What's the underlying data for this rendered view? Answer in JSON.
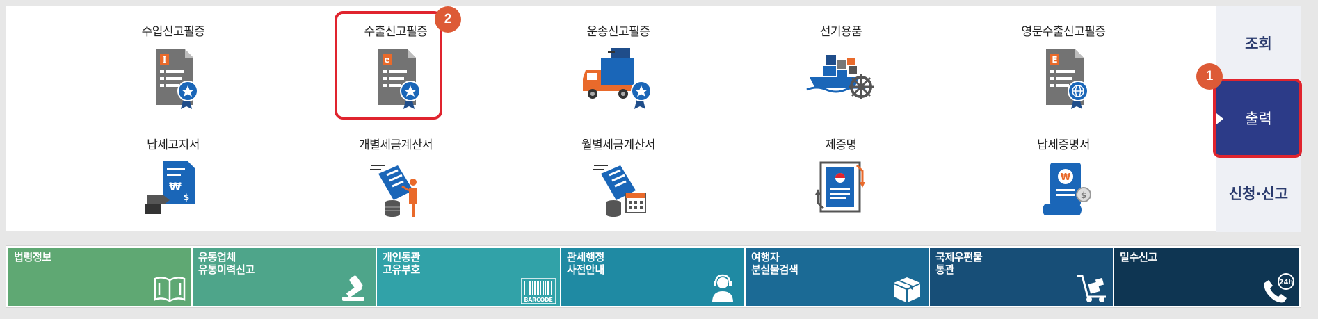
{
  "top_items": [
    {
      "label": "수입신고필증",
      "icon": "import-certificate-icon"
    },
    {
      "label": "수출신고필증",
      "icon": "export-certificate-icon"
    },
    {
      "label": "운송신고필증",
      "icon": "transport-certificate-icon"
    },
    {
      "label": "선기용품",
      "icon": "ship-supplies-icon"
    },
    {
      "label": "영문수출신고필증",
      "icon": "english-export-certificate-icon"
    },
    {
      "label": "납세고지서",
      "icon": "tax-notice-icon"
    },
    {
      "label": "개별세금계산서",
      "icon": "individual-tax-invoice-icon"
    },
    {
      "label": "월별세금계산서",
      "icon": "monthly-tax-invoice-icon"
    },
    {
      "label": "제증명",
      "icon": "certificate-icon"
    },
    {
      "label": "납세증명서",
      "icon": "tax-payment-certificate-icon"
    }
  ],
  "side_menu": [
    {
      "label": "조회",
      "active": false
    },
    {
      "label": "출력",
      "active": true
    },
    {
      "label": "신청·신고",
      "active": false
    }
  ],
  "badges": {
    "side": "1",
    "item": "2"
  },
  "tiles": [
    {
      "line1": "법령정보",
      "line2": "",
      "icon": "book-icon",
      "color": "#5fa873"
    },
    {
      "line1": "유통업체",
      "line2": "유통이력신고",
      "icon": "stamp-icon",
      "color": "#4ea58a"
    },
    {
      "line1": "개인통관",
      "line2": "고유부호",
      "icon": "barcode-icon",
      "barcode_text": "BARCODE",
      "color": "#31a2a8"
    },
    {
      "line1": "관세행정",
      "line2": "사전안내",
      "icon": "call-agent-icon",
      "color": "#1f8aa3"
    },
    {
      "line1": "여행자",
      "line2": "분실물검색",
      "icon": "package-icon",
      "color": "#1b6a95"
    },
    {
      "line1": "국제우편물",
      "line2": "통관",
      "icon": "hand-truck-icon",
      "color": "#174e77"
    },
    {
      "line1": "밀수신고",
      "line2": "",
      "icon": "phone-24h-icon",
      "phone_text": "24h",
      "color": "#0e3552"
    }
  ],
  "colors": {
    "accent_red": "#e0242e",
    "badge": "#dd5a36",
    "side_active": "#2c3b88",
    "doc_gray": "#6f6f6f",
    "blue": "#1a66b8",
    "orange": "#e96a2b"
  }
}
